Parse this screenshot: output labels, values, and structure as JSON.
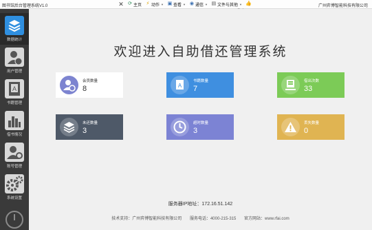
{
  "window": {
    "title": "图书馆后台管理系统V1.0",
    "company": "广州弈博智能科技有限公司"
  },
  "toolbar": {
    "items": [
      {
        "icon": "close-icon",
        "label": ""
      },
      {
        "icon": "refresh-icon",
        "label": "主页"
      },
      {
        "icon": "lightning-icon",
        "label": "动作"
      },
      {
        "icon": "view-icon",
        "label": "查看"
      },
      {
        "icon": "communication-icon",
        "label": "通信"
      },
      {
        "icon": "file-icon",
        "label": "文件与其他"
      },
      {
        "icon": "thumbs-up-icon",
        "label": ""
      }
    ]
  },
  "sidebar": {
    "items": [
      {
        "label": "数据统计",
        "icon": "stats-icon",
        "active": true
      },
      {
        "label": "用户管理",
        "icon": "user-icon",
        "active": false
      },
      {
        "label": "书籍管理",
        "icon": "book-icon",
        "active": false
      },
      {
        "label": "借书情况",
        "icon": "bar-chart-icon",
        "active": false
      },
      {
        "label": "账号管理",
        "icon": "account-icon",
        "active": false
      },
      {
        "label": "系统设置",
        "icon": "settings-icon",
        "active": false
      }
    ],
    "power_icon": "power-icon"
  },
  "main": {
    "heading": "欢迎进入自助借还管理系统",
    "cards": [
      {
        "label": "会员数量",
        "value": "8",
        "icon": "member-icon",
        "color": "#ffffff"
      },
      {
        "label": "书籍数量",
        "value": "7",
        "icon": "book-icon",
        "color": "#3f8fe0"
      },
      {
        "label": "借出次数",
        "value": "33",
        "icon": "borrow-icon",
        "color": "#7ccb57"
      },
      {
        "label": "未还数量",
        "value": "3",
        "icon": "layers-icon",
        "color": "#4e5968"
      },
      {
        "label": "超时数量",
        "value": "3",
        "icon": "clock-icon",
        "color": "#7c83d4"
      },
      {
        "label": "丢失数量",
        "value": "0",
        "icon": "warning-icon",
        "color": "#e0b452"
      }
    ],
    "server": "服务器IP地址：172.16.51.142",
    "footer": {
      "support": "技术支持：广州弈博智能科技有限公司",
      "phone": "服务电话：4000-215-315",
      "website": "官方网站：www.rfai.com"
    }
  }
}
